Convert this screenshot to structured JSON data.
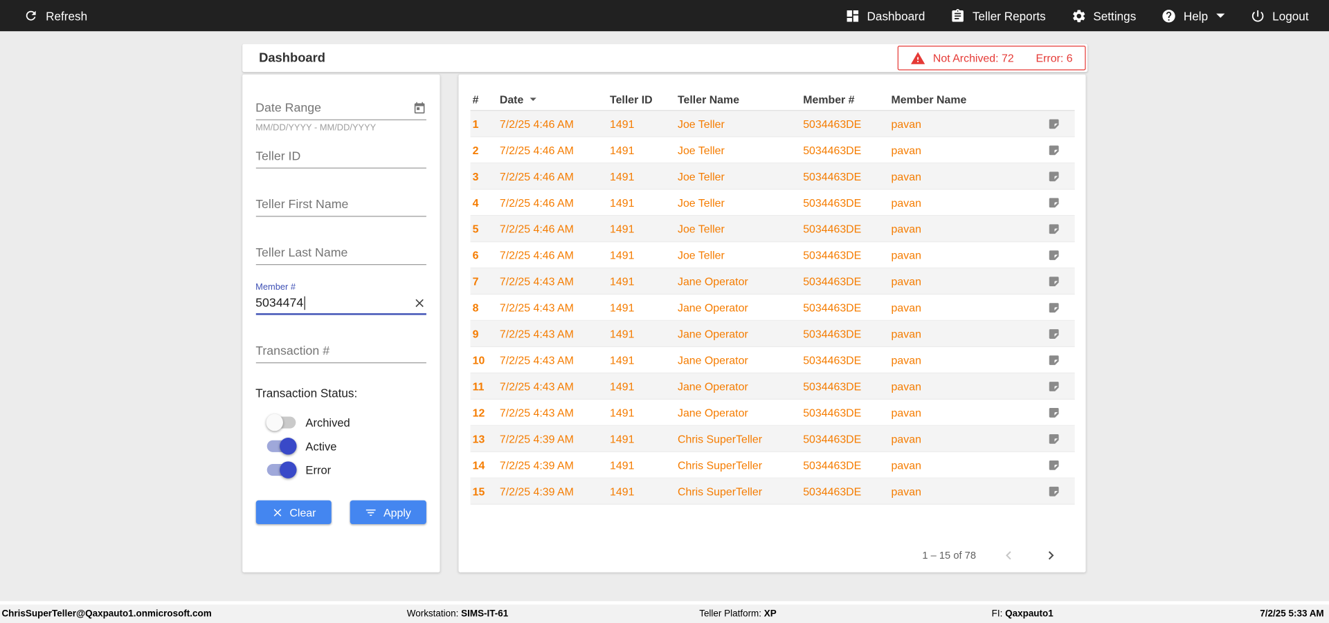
{
  "topbar": {
    "refresh_label": "Refresh",
    "nav": [
      {
        "label": "Dashboard"
      },
      {
        "label": "Teller Reports"
      },
      {
        "label": "Settings"
      },
      {
        "label": "Help"
      },
      {
        "label": "Logout"
      }
    ]
  },
  "header": {
    "title": "Dashboard",
    "alert": {
      "not_archived": "Not Archived: 72",
      "error": "Error: 6"
    }
  },
  "filters": {
    "date_range": {
      "placeholder": "Date Range",
      "hint": "MM/DD/YYYY - MM/DD/YYYY"
    },
    "teller_id": {
      "placeholder": "Teller ID"
    },
    "teller_first_name": {
      "placeholder": "Teller First Name"
    },
    "teller_last_name": {
      "placeholder": "Teller Last Name"
    },
    "member_number": {
      "label": "Member #",
      "value": "5034474"
    },
    "transaction_number": {
      "placeholder": "Transaction #"
    },
    "status": {
      "label": "Transaction Status:",
      "toggles": [
        {
          "label": "Archived",
          "on": false
        },
        {
          "label": "Active",
          "on": true
        },
        {
          "label": "Error",
          "on": true
        }
      ]
    },
    "buttons": {
      "clear": "Clear",
      "apply": "Apply"
    }
  },
  "table": {
    "columns": [
      "#",
      "Date",
      "Teller ID",
      "Teller Name",
      "Member #",
      "Member Name"
    ],
    "rows": [
      {
        "num": "1",
        "date": "7/2/25 4:46 AM",
        "teller_id": "1491",
        "teller_name": "Joe Teller",
        "member": "5034463DE",
        "member_name": "pavan"
      },
      {
        "num": "2",
        "date": "7/2/25 4:46 AM",
        "teller_id": "1491",
        "teller_name": "Joe Teller",
        "member": "5034463DE",
        "member_name": "pavan"
      },
      {
        "num": "3",
        "date": "7/2/25 4:46 AM",
        "teller_id": "1491",
        "teller_name": "Joe Teller",
        "member": "5034463DE",
        "member_name": "pavan"
      },
      {
        "num": "4",
        "date": "7/2/25 4:46 AM",
        "teller_id": "1491",
        "teller_name": "Joe Teller",
        "member": "5034463DE",
        "member_name": "pavan"
      },
      {
        "num": "5",
        "date": "7/2/25 4:46 AM",
        "teller_id": "1491",
        "teller_name": "Joe Teller",
        "member": "5034463DE",
        "member_name": "pavan"
      },
      {
        "num": "6",
        "date": "7/2/25 4:46 AM",
        "teller_id": "1491",
        "teller_name": "Joe Teller",
        "member": "5034463DE",
        "member_name": "pavan"
      },
      {
        "num": "7",
        "date": "7/2/25 4:43 AM",
        "teller_id": "1491",
        "teller_name": "Jane Operator",
        "member": "5034463DE",
        "member_name": "pavan"
      },
      {
        "num": "8",
        "date": "7/2/25 4:43 AM",
        "teller_id": "1491",
        "teller_name": "Jane Operator",
        "member": "5034463DE",
        "member_name": "pavan"
      },
      {
        "num": "9",
        "date": "7/2/25 4:43 AM",
        "teller_id": "1491",
        "teller_name": "Jane Operator",
        "member": "5034463DE",
        "member_name": "pavan"
      },
      {
        "num": "10",
        "date": "7/2/25 4:43 AM",
        "teller_id": "1491",
        "teller_name": "Jane Operator",
        "member": "5034463DE",
        "member_name": "pavan"
      },
      {
        "num": "11",
        "date": "7/2/25 4:43 AM",
        "teller_id": "1491",
        "teller_name": "Jane Operator",
        "member": "5034463DE",
        "member_name": "pavan"
      },
      {
        "num": "12",
        "date": "7/2/25 4:43 AM",
        "teller_id": "1491",
        "teller_name": "Jane Operator",
        "member": "5034463DE",
        "member_name": "pavan"
      },
      {
        "num": "13",
        "date": "7/2/25 4:39 AM",
        "teller_id": "1491",
        "teller_name": "Chris SuperTeller",
        "member": "5034463DE",
        "member_name": "pavan"
      },
      {
        "num": "14",
        "date": "7/2/25 4:39 AM",
        "teller_id": "1491",
        "teller_name": "Chris SuperTeller",
        "member": "5034463DE",
        "member_name": "pavan"
      },
      {
        "num": "15",
        "date": "7/2/25 4:39 AM",
        "teller_id": "1491",
        "teller_name": "Chris SuperTeller",
        "member": "5034463DE",
        "member_name": "pavan"
      }
    ],
    "pagination": {
      "range": "1 – 15 of 78"
    }
  },
  "footer": {
    "user": "ChrisSuperTeller@Qaxpauto1.onmicrosoft.com",
    "workstation_label": "Workstation:",
    "workstation": "SIMS-IT-61",
    "platform_label": "Teller Platform:",
    "platform": "XP",
    "fi_label": "FI:",
    "fi": "Qaxpauto1",
    "datetime": "7/2/25 5:33 AM"
  }
}
